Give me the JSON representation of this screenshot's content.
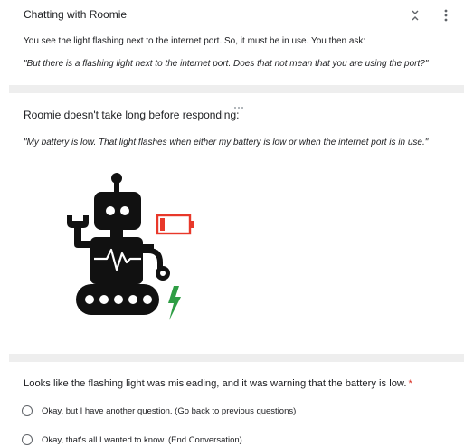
{
  "section1": {
    "title": "Chatting with Roomie",
    "text": "You see the light flashing next to the internet port. So, it must be in use. You then ask:",
    "quote": "\"But there is a flashing light next to the internet port. Does that not mean that you are using the port?\""
  },
  "section2": {
    "heading": "Roomie doesn't take long before responding:",
    "quote": "\"My battery is low. That light flashes when either my battery is low or when the internet port is in use.\""
  },
  "question": {
    "text": "Looks like the flashing light was misleading, and it was warning that the battery is low.",
    "required_mark": "*",
    "options": [
      {
        "label": "Okay, but I have another question. (Go back to previous questions)",
        "selected": false
      },
      {
        "label": "Okay, that's all I wanted to know. (End Conversation)",
        "selected": false
      }
    ]
  },
  "colors": {
    "battery": "#e8382a",
    "bolt": "#2e9d44",
    "robot": "#111111",
    "divider": "#eeeeee",
    "required": "#d93025"
  },
  "icons": [
    "collapse-icon",
    "more-vert-icon",
    "drag-handle-icon",
    "robot-illustration",
    "low-battery-icon",
    "lightning-bolt-icon"
  ]
}
